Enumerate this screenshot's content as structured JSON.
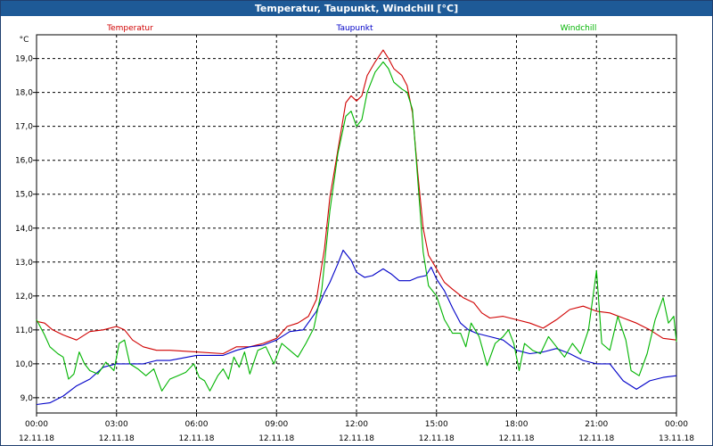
{
  "window": {
    "title": "Temperatur, Taupunkt, Windchill [°C]"
  },
  "chart_data": {
    "type": "line",
    "title": "Temperatur, Taupunkt, Windchill [°C]",
    "ylabel": "°C",
    "xlabel": "",
    "ylim": [
      8.55,
      19.7
    ],
    "xlim": [
      0,
      24
    ],
    "grid": true,
    "legend": "top",
    "y_ticks": [
      "9,0",
      "10,0",
      "11,0",
      "12,0",
      "13,0",
      "14,0",
      "15,0",
      "16,0",
      "17,0",
      "18,0",
      "19,0"
    ],
    "x_ticks": [
      {
        "time": "00:00",
        "date": "12.11.18"
      },
      {
        "time": "03:00",
        "date": "12.11.18"
      },
      {
        "time": "06:00",
        "date": "12.11.18"
      },
      {
        "time": "09:00",
        "date": "12.11.18"
      },
      {
        "time": "12:00",
        "date": "12.11.18"
      },
      {
        "time": "15:00",
        "date": "12.11.18"
      },
      {
        "time": "18:00",
        "date": "12.11.18"
      },
      {
        "time": "21:00",
        "date": "12.11.18"
      },
      {
        "time": "00:00",
        "date": "13.11.18"
      }
    ],
    "series": [
      {
        "name": "Temperatur",
        "color": "#d00000",
        "points": [
          [
            0,
            11.25
          ],
          [
            0.3,
            11.2
          ],
          [
            0.6,
            11.0
          ],
          [
            1,
            10.85
          ],
          [
            1.5,
            10.7
          ],
          [
            2,
            10.95
          ],
          [
            2.5,
            11.0
          ],
          [
            3,
            11.1
          ],
          [
            3.3,
            11.0
          ],
          [
            3.6,
            10.7
          ],
          [
            4,
            10.5
          ],
          [
            4.5,
            10.4
          ],
          [
            5,
            10.4
          ],
          [
            6,
            10.35
          ],
          [
            7,
            10.3
          ],
          [
            7.5,
            10.5
          ],
          [
            8,
            10.5
          ],
          [
            8.5,
            10.6
          ],
          [
            9,
            10.75
          ],
          [
            9.4,
            11.1
          ],
          [
            9.8,
            11.2
          ],
          [
            10.2,
            11.4
          ],
          [
            10.5,
            11.9
          ],
          [
            10.8,
            13.4
          ],
          [
            11,
            14.9
          ],
          [
            11.3,
            16.3
          ],
          [
            11.6,
            17.7
          ],
          [
            11.8,
            17.9
          ],
          [
            12,
            17.75
          ],
          [
            12.2,
            17.9
          ],
          [
            12.4,
            18.5
          ],
          [
            12.7,
            18.9
          ],
          [
            13,
            19.25
          ],
          [
            13.2,
            19.0
          ],
          [
            13.4,
            18.7
          ],
          [
            13.7,
            18.5
          ],
          [
            13.9,
            18.2
          ],
          [
            14.1,
            17.4
          ],
          [
            14.3,
            15.6
          ],
          [
            14.5,
            14.0
          ],
          [
            14.7,
            13.2
          ],
          [
            15,
            12.8
          ],
          [
            15.3,
            12.4
          ],
          [
            15.6,
            12.2
          ],
          [
            16,
            11.95
          ],
          [
            16.4,
            11.8
          ],
          [
            16.7,
            11.5
          ],
          [
            17,
            11.35
          ],
          [
            17.5,
            11.4
          ],
          [
            18,
            11.3
          ],
          [
            18.5,
            11.2
          ],
          [
            19,
            11.05
          ],
          [
            19.5,
            11.3
          ],
          [
            20,
            11.6
          ],
          [
            20.5,
            11.7
          ],
          [
            21,
            11.55
          ],
          [
            21.5,
            11.5
          ],
          [
            22,
            11.35
          ],
          [
            22.5,
            11.2
          ],
          [
            23,
            11.0
          ],
          [
            23.5,
            10.75
          ],
          [
            24,
            10.7
          ]
        ]
      },
      {
        "name": "Taupunkt",
        "color": "#0000c8",
        "points": [
          [
            0,
            8.8
          ],
          [
            0.5,
            8.85
          ],
          [
            1,
            9.05
          ],
          [
            1.5,
            9.35
          ],
          [
            2,
            9.55
          ],
          [
            2.5,
            9.9
          ],
          [
            3,
            10.0
          ],
          [
            4,
            10.0
          ],
          [
            4.5,
            10.1
          ],
          [
            5,
            10.1
          ],
          [
            6,
            10.25
          ],
          [
            7,
            10.25
          ],
          [
            7.5,
            10.4
          ],
          [
            8,
            10.5
          ],
          [
            8.5,
            10.55
          ],
          [
            9,
            10.7
          ],
          [
            9.5,
            10.95
          ],
          [
            10,
            11.0
          ],
          [
            10.5,
            11.55
          ],
          [
            10.8,
            12.1
          ],
          [
            11,
            12.4
          ],
          [
            11.3,
            12.95
          ],
          [
            11.5,
            13.35
          ],
          [
            11.8,
            13.05
          ],
          [
            12,
            12.7
          ],
          [
            12.3,
            12.55
          ],
          [
            12.6,
            12.6
          ],
          [
            13,
            12.8
          ],
          [
            13.3,
            12.65
          ],
          [
            13.6,
            12.45
          ],
          [
            14,
            12.45
          ],
          [
            14.3,
            12.55
          ],
          [
            14.6,
            12.6
          ],
          [
            14.8,
            12.85
          ],
          [
            15,
            12.5
          ],
          [
            15.3,
            12.15
          ],
          [
            15.6,
            11.65
          ],
          [
            15.9,
            11.2
          ],
          [
            16.2,
            11.0
          ],
          [
            16.5,
            10.9
          ],
          [
            17,
            10.8
          ],
          [
            17.5,
            10.7
          ],
          [
            18,
            10.4
          ],
          [
            18.5,
            10.3
          ],
          [
            19,
            10.35
          ],
          [
            19.5,
            10.45
          ],
          [
            20,
            10.3
          ],
          [
            20.5,
            10.1
          ],
          [
            21,
            10.0
          ],
          [
            21.5,
            10.0
          ],
          [
            22,
            9.5
          ],
          [
            22.5,
            9.25
          ],
          [
            23,
            9.5
          ],
          [
            23.5,
            9.6
          ],
          [
            24,
            9.65
          ]
        ]
      },
      {
        "name": "Windchill",
        "color": "#00b400",
        "points": [
          [
            0,
            11.3
          ],
          [
            0.3,
            10.85
          ],
          [
            0.5,
            10.5
          ],
          [
            0.8,
            10.3
          ],
          [
            1,
            10.2
          ],
          [
            1.2,
            9.55
          ],
          [
            1.4,
            9.7
          ],
          [
            1.6,
            10.35
          ],
          [
            1.8,
            10.0
          ],
          [
            2,
            9.8
          ],
          [
            2.3,
            9.7
          ],
          [
            2.6,
            10.05
          ],
          [
            2.9,
            9.8
          ],
          [
            3.1,
            10.6
          ],
          [
            3.3,
            10.7
          ],
          [
            3.5,
            10.0
          ],
          [
            3.8,
            9.85
          ],
          [
            4.1,
            9.65
          ],
          [
            4.4,
            9.85
          ],
          [
            4.7,
            9.2
          ],
          [
            5,
            9.55
          ],
          [
            5.3,
            9.65
          ],
          [
            5.6,
            9.75
          ],
          [
            5.9,
            10.0
          ],
          [
            6.1,
            9.6
          ],
          [
            6.3,
            9.5
          ],
          [
            6.5,
            9.2
          ],
          [
            6.8,
            9.65
          ],
          [
            7,
            9.85
          ],
          [
            7.2,
            9.55
          ],
          [
            7.4,
            10.2
          ],
          [
            7.6,
            9.9
          ],
          [
            7.8,
            10.35
          ],
          [
            8,
            9.7
          ],
          [
            8.3,
            10.4
          ],
          [
            8.6,
            10.5
          ],
          [
            8.9,
            10.0
          ],
          [
            9.2,
            10.6
          ],
          [
            9.5,
            10.4
          ],
          [
            9.8,
            10.2
          ],
          [
            10.1,
            10.6
          ],
          [
            10.4,
            11.05
          ],
          [
            10.7,
            12.2
          ],
          [
            11,
            14.5
          ],
          [
            11.3,
            16.2
          ],
          [
            11.6,
            17.3
          ],
          [
            11.8,
            17.45
          ],
          [
            12,
            17.0
          ],
          [
            12.2,
            17.2
          ],
          [
            12.4,
            18.0
          ],
          [
            12.7,
            18.6
          ],
          [
            13,
            18.9
          ],
          [
            13.2,
            18.7
          ],
          [
            13.4,
            18.3
          ],
          [
            13.7,
            18.1
          ],
          [
            13.9,
            18.0
          ],
          [
            14.1,
            17.5
          ],
          [
            14.3,
            15.4
          ],
          [
            14.5,
            13.3
          ],
          [
            14.7,
            12.3
          ],
          [
            15,
            12.0
          ],
          [
            15.3,
            11.3
          ],
          [
            15.6,
            10.9
          ],
          [
            15.9,
            10.9
          ],
          [
            16.1,
            10.5
          ],
          [
            16.3,
            11.2
          ],
          [
            16.6,
            10.8
          ],
          [
            16.9,
            9.95
          ],
          [
            17.2,
            10.6
          ],
          [
            17.5,
            10.8
          ],
          [
            17.7,
            11.0
          ],
          [
            17.9,
            10.6
          ],
          [
            18.1,
            9.8
          ],
          [
            18.3,
            10.6
          ],
          [
            18.6,
            10.4
          ],
          [
            18.9,
            10.3
          ],
          [
            19.2,
            10.8
          ],
          [
            19.5,
            10.5
          ],
          [
            19.8,
            10.2
          ],
          [
            20.1,
            10.6
          ],
          [
            20.4,
            10.3
          ],
          [
            20.7,
            11.0
          ],
          [
            21,
            12.75
          ],
          [
            21.2,
            10.6
          ],
          [
            21.5,
            10.4
          ],
          [
            21.8,
            11.4
          ],
          [
            22.1,
            10.7
          ],
          [
            22.3,
            9.8
          ],
          [
            22.6,
            9.65
          ],
          [
            22.9,
            10.3
          ],
          [
            23.2,
            11.3
          ],
          [
            23.5,
            11.95
          ],
          [
            23.7,
            11.2
          ],
          [
            23.9,
            11.4
          ],
          [
            24,
            10.65
          ]
        ]
      }
    ]
  }
}
